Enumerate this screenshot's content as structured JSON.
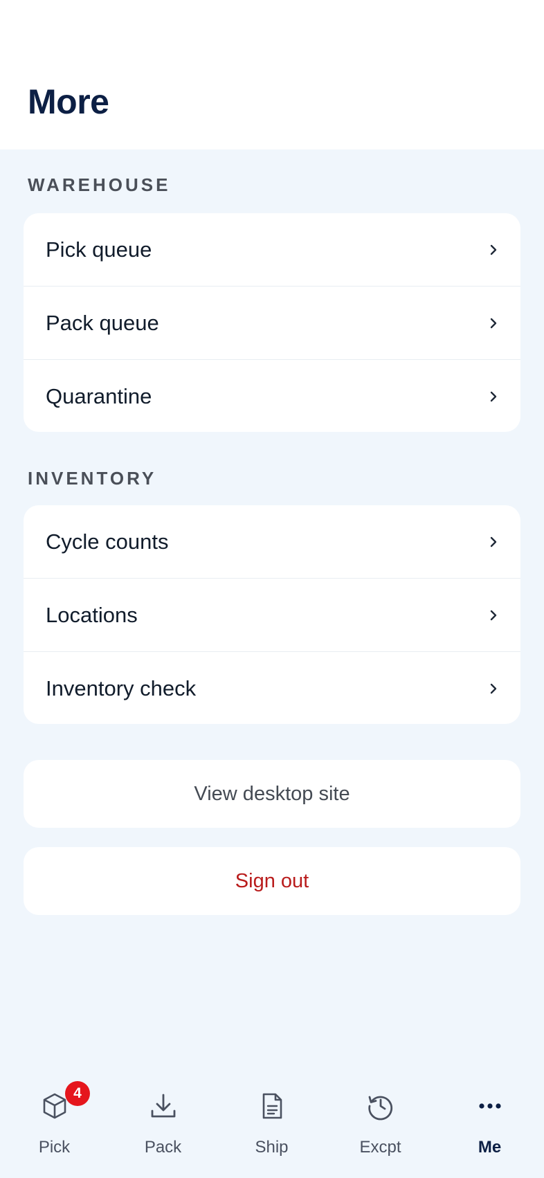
{
  "header": {
    "title": "More"
  },
  "sections": [
    {
      "label": "WAREHOUSE",
      "items": [
        {
          "label": "Pick queue"
        },
        {
          "label": "Pack queue"
        },
        {
          "label": "Quarantine"
        }
      ]
    },
    {
      "label": "INVENTORY",
      "items": [
        {
          "label": "Cycle counts"
        },
        {
          "label": "Locations"
        },
        {
          "label": "Inventory check"
        }
      ]
    }
  ],
  "actions": {
    "desktop_label": "View desktop site",
    "signout_label": "Sign out"
  },
  "tabbar": {
    "tabs": [
      {
        "label": "Pick",
        "icon": "box-icon",
        "badge": "4"
      },
      {
        "label": "Pack",
        "icon": "download-icon"
      },
      {
        "label": "Ship",
        "icon": "document-icon"
      },
      {
        "label": "Excpt",
        "icon": "history-icon"
      },
      {
        "label": "Me",
        "icon": "more-dots-icon",
        "active": true
      }
    ]
  },
  "colors": {
    "background": "#f0f6fc",
    "title": "#0c1f44",
    "signout": "#b91c1c",
    "badge": "#e5161d"
  }
}
